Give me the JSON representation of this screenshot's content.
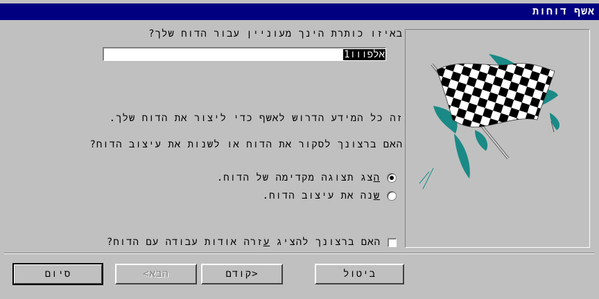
{
  "window": {
    "title": "אשף דוחות"
  },
  "main": {
    "question_title": "באיזו כותרת הינך מעוניין עבור הדוח שלך?",
    "title_value": "אלפווו1",
    "info_text": "זה כל המידע הדרוש לאשף כדי ליצור את הדוח שלך.",
    "question_action": "האם ברצונך לסקור את הדוח או לשנות את עיצוב הדוח?",
    "radio_options": [
      {
        "mnemonic": "ה",
        "rest": "צג תצוגה מקדימה של הדוח.",
        "selected": true
      },
      {
        "mnemonic": "ש",
        "rest": "נה את עיצוב הדוח.",
        "selected": false
      }
    ],
    "help_checkbox": {
      "pre": "האם ברצונך להציג ",
      "mnemonic": "ע",
      "post": "זרה אודות עבודה עם הדוח?",
      "checked": false
    }
  },
  "buttons": {
    "cancel": "ביטול",
    "back": "<קודם",
    "next": "הבא>",
    "finish": "סיום"
  },
  "colors": {
    "titlebar": "#000080",
    "face": "#c0c0c0",
    "flag_accent": "#1a8a86"
  }
}
